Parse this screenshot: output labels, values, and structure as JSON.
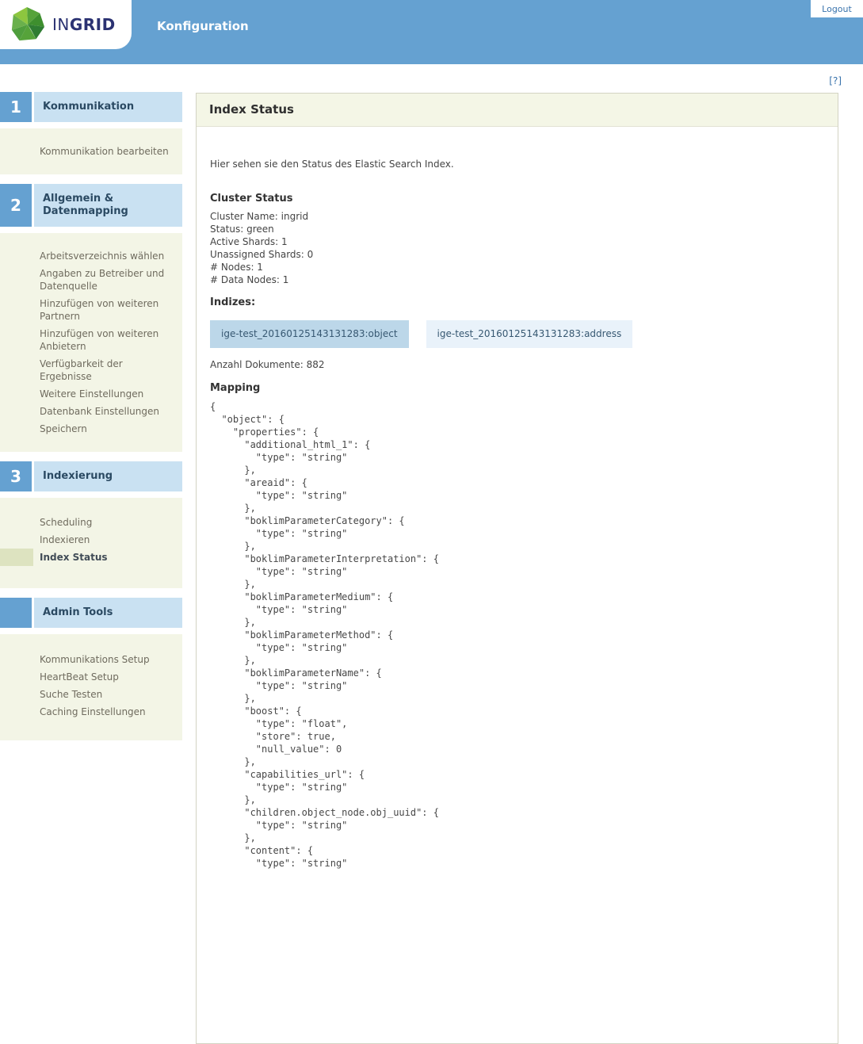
{
  "header": {
    "brand_light": "IN",
    "brand_bold": "GRID",
    "app_title": "Konfiguration",
    "logout_label": "Logout",
    "help_label": "[?]"
  },
  "sidebar": {
    "sections": [
      {
        "num": "1",
        "title": "Kommunikation",
        "items": [
          {
            "label": "Kommunikation bearbeiten"
          }
        ]
      },
      {
        "num": "2",
        "title": "Allgemein & Datenmapping",
        "items": [
          {
            "label": "Arbeitsverzeichnis wählen"
          },
          {
            "label": "Angaben zu Betreiber und Datenquelle"
          },
          {
            "label": "Hinzufügen von weiteren Partnern"
          },
          {
            "label": "Hinzufügen von weiteren Anbietern"
          },
          {
            "label": "Verfügbarkeit der Ergebnisse"
          },
          {
            "label": "Weitere Einstellungen"
          },
          {
            "label": "Datenbank Einstellungen"
          },
          {
            "label": "Speichern"
          }
        ]
      },
      {
        "num": "3",
        "title": "Indexierung",
        "items": [
          {
            "label": "Scheduling"
          },
          {
            "label": "Indexieren"
          },
          {
            "label": "Index Status",
            "active": true
          }
        ]
      },
      {
        "num": "",
        "title": "Admin Tools",
        "items": [
          {
            "label": "Kommunikations Setup"
          },
          {
            "label": "HeartBeat Setup"
          },
          {
            "label": "Suche Testen"
          },
          {
            "label": "Caching Einstellungen"
          }
        ]
      }
    ]
  },
  "main": {
    "title": "Index Status",
    "intro": "Hier sehen sie den Status des Elastic Search Index.",
    "cluster": {
      "heading": "Cluster Status",
      "lines": [
        "Cluster Name: ingrid",
        "Status: green",
        "Active Shards: 1",
        "Unassigned Shards: 0",
        "# Nodes: 1",
        "# Data Nodes: 1"
      ]
    },
    "indices": {
      "heading": "Indizes:",
      "buttons": [
        "ige-test_20160125143131283:object",
        "ige-test_20160125143131283:address"
      ],
      "selected_index": 0
    },
    "documents_count_label": "Anzahl Dokumente: 882",
    "mapping_heading": "Mapping",
    "mapping_json": "{\n  \"object\": {\n    \"properties\": {\n      \"additional_html_1\": {\n        \"type\": \"string\"\n      },\n      \"areaid\": {\n        \"type\": \"string\"\n      },\n      \"boklimParameterCategory\": {\n        \"type\": \"string\"\n      },\n      \"boklimParameterInterpretation\": {\n        \"type\": \"string\"\n      },\n      \"boklimParameterMedium\": {\n        \"type\": \"string\"\n      },\n      \"boklimParameterMethod\": {\n        \"type\": \"string\"\n      },\n      \"boklimParameterName\": {\n        \"type\": \"string\"\n      },\n      \"boost\": {\n        \"type\": \"float\",\n        \"store\": true,\n        \"null_value\": 0\n      },\n      \"capabilities_url\": {\n        \"type\": \"string\"\n      },\n      \"children.object_node.obj_uuid\": {\n        \"type\": \"string\"\n      },\n      \"content\": {\n        \"type\": \"string\""
  },
  "colors": {
    "header_blue": "#65a1d1",
    "section_bar_blue": "#c9e1f2",
    "cream_panel": "#f3f5e6",
    "active_highlight_olive": "#dde3c0",
    "link_blue": "#3973ac",
    "tab_selected_bg": "#bcd7e9",
    "tab_bg": "#e9f2fa",
    "status_value": "green"
  }
}
